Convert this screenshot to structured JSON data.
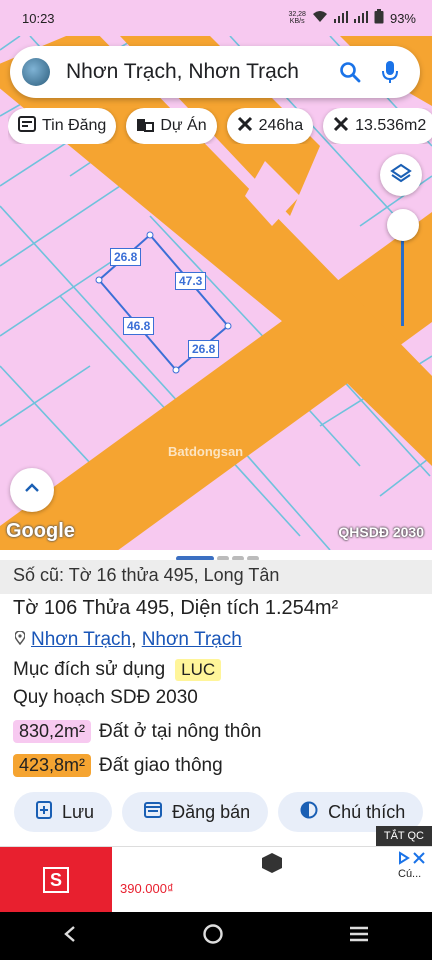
{
  "status": {
    "time": "10:23",
    "speed_value": "32,28",
    "speed_unit": "KB/s",
    "battery": "93%"
  },
  "search": {
    "query": "Nhơn Trạch, Nhơn Trạch"
  },
  "chips": [
    {
      "icon": "news-icon",
      "label": "Tin Đăng"
    },
    {
      "icon": "building-icon",
      "label": "Dự Án"
    },
    {
      "icon": "measure-icon",
      "label": "246ha"
    },
    {
      "icon": "measure-icon",
      "label": "13.536m2"
    }
  ],
  "map": {
    "dimensions": [
      "26.8",
      "47.3",
      "46.8",
      "26.8"
    ],
    "watermark": "Batdongsan",
    "google_label": "Google",
    "layer_label": "QHSDĐ 2030"
  },
  "parcel": {
    "old_ref": "Số cũ: Tờ 16 thửa 495, Long Tân",
    "title": "Tờ 106 Thửa 495, Diện tích 1.254m²",
    "location_a": "Nhơn Trạch",
    "location_sep": ", ",
    "location_b": "Nhơn Trạch",
    "purpose_label": "Mục đích sử dụng",
    "purpose_code": "LUC",
    "plan_label": "Quy hoạch SDĐ 2030",
    "areas": [
      {
        "value": "830,2m²",
        "label": "Đất ở tại nông thôn",
        "color": "#f7c9f0"
      },
      {
        "value": "423,8m²",
        "label": "Đất giao thông",
        "color": "#f5a431"
      }
    ]
  },
  "actions": {
    "save": "Lưu",
    "sell": "Đăng bán",
    "legend": "Chú thích"
  },
  "ad": {
    "close_label": "TẮT QC",
    "price": "390.000₫",
    "side_text": "Cú..."
  },
  "colors": {
    "land": "#f7c9f0",
    "road": "#f5a431",
    "plot": "#3b6fd6",
    "accent": "#1a73e8"
  }
}
